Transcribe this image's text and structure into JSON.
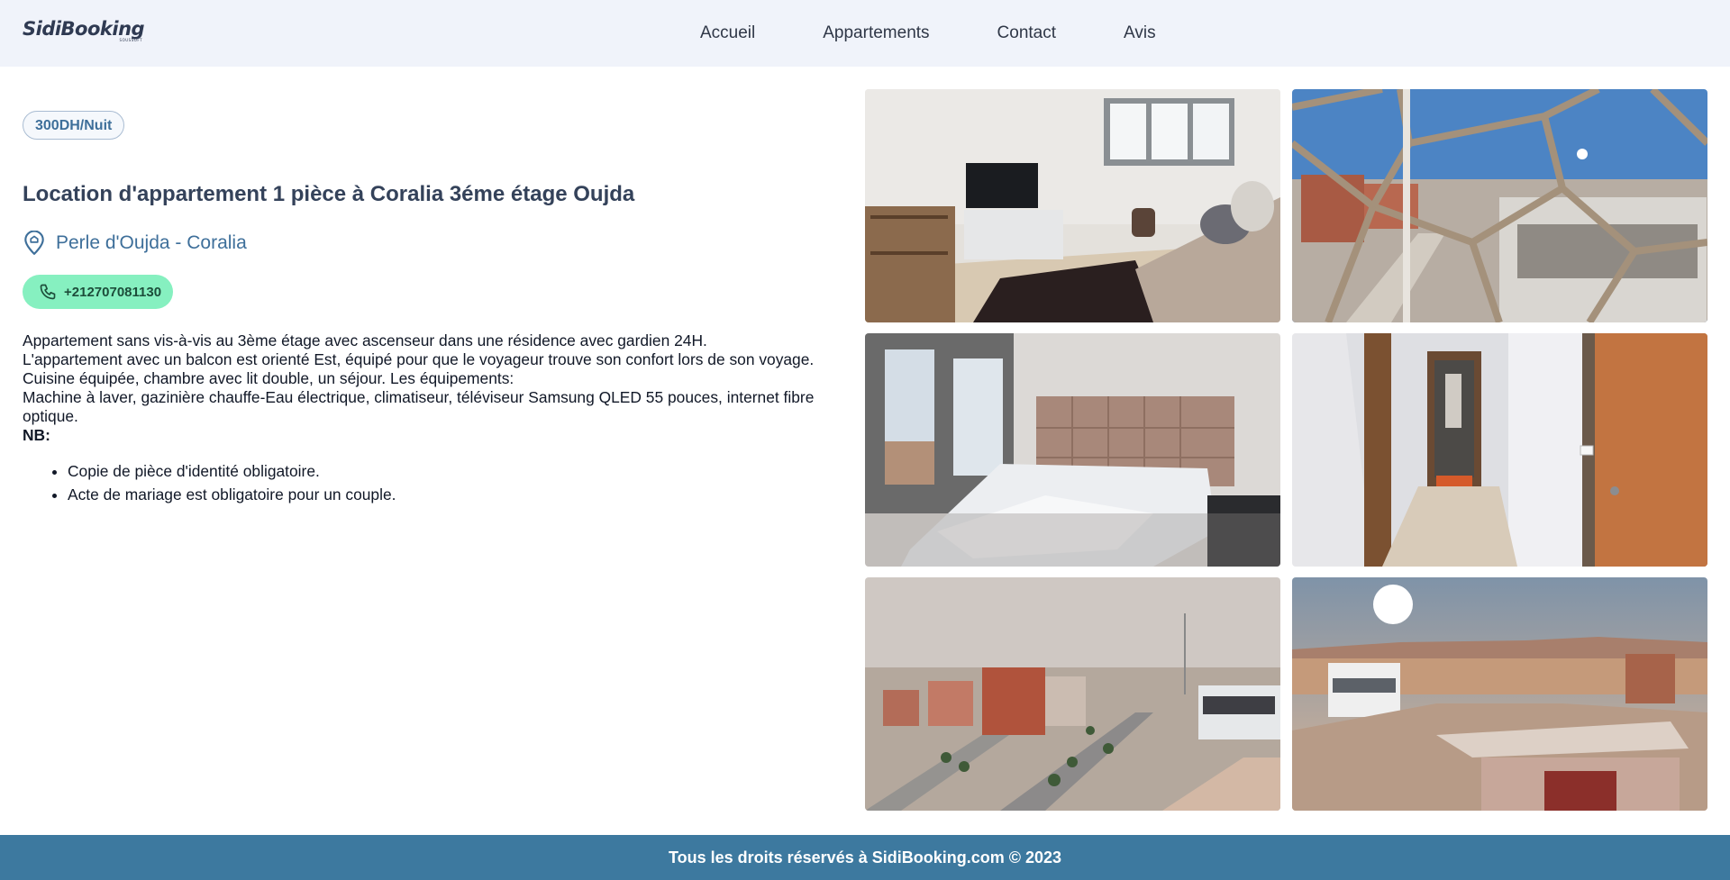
{
  "header": {
    "logo_text": "SidiBooking",
    "logo_sub": "SOUSSOFT",
    "nav": [
      "Accueil",
      "Appartements",
      "Contact",
      "Avis"
    ]
  },
  "listing": {
    "price": "300DH/Nuit",
    "title": "Location d'appartement 1 pièce à Coralia 3éme étage Oujda",
    "location": "Perle d'Oujda - Coralia",
    "phone": "+212707081130",
    "description_lines": [
      "Appartement sans vis-à-vis au 3ème étage avec ascenseur dans une résidence avec gardien 24H.",
      "L'appartement avec un balcon est orienté Est, équipé pour que le voyageur trouve son confort lors de son voyage. Cuisine équipée, chambre avec lit double, un séjour. Les équipements:",
      "Machine à laver, gazinière chauffe-Eau électrique, climatiseur, téléviseur Samsung QLED 55 pouces, internet fibre optique."
    ],
    "nb_label": "NB:",
    "nb_items": [
      "Copie de pièce d'identité obligatoire.",
      "Acte de mariage est obligatoire pour un couple."
    ]
  },
  "footer": {
    "text": "Tous les droits réservés à SidiBooking.com © 2023"
  },
  "colors": {
    "header_bg": "#f0f3fa",
    "accent": "#3e6f9a",
    "phone_bg": "#86f0c0",
    "footer_bg": "#3d799f"
  },
  "icons": {
    "location": "map-pin-icon",
    "phone": "phone-icon"
  }
}
